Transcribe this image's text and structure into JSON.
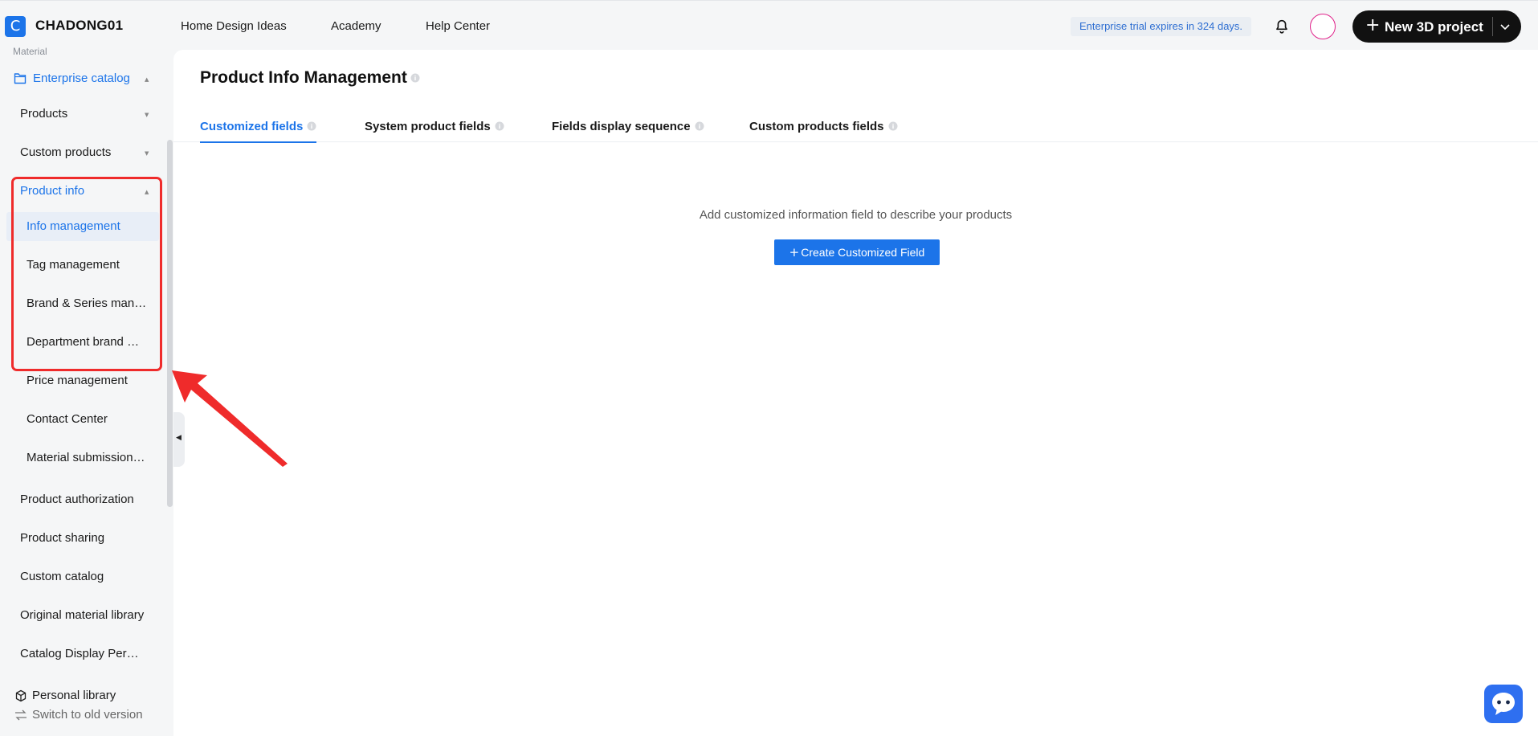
{
  "header": {
    "logo_letter": "C",
    "brand": "CHADONG01",
    "nav": [
      "Home Design Ideas",
      "Academy",
      "Help Center"
    ],
    "trial_notice": "Enterprise trial expires in 324 days.",
    "new_project_label": "New 3D project"
  },
  "sidebar": {
    "section_label": "Material",
    "catalog_label": "Enterprise catalog",
    "items": [
      {
        "label": "Products"
      },
      {
        "label": "Custom products"
      },
      {
        "label": "Product info"
      },
      {
        "label": "Info management"
      },
      {
        "label": "Tag management"
      },
      {
        "label": "Brand & Series management"
      },
      {
        "label": "Department brand management"
      },
      {
        "label": "Price management"
      },
      {
        "label": "Contact Center"
      },
      {
        "label": "Material submission management"
      },
      {
        "label": "Product authorization"
      },
      {
        "label": "Product sharing"
      },
      {
        "label": "Custom catalog"
      },
      {
        "label": "Original material library"
      },
      {
        "label": "Catalog Display Permissions"
      }
    ],
    "personal_library": "Personal library",
    "switch_version": "Switch to old version"
  },
  "main": {
    "title": "Product Info Management",
    "tabs": [
      {
        "label": "Customized fields",
        "active": true
      },
      {
        "label": "System product fields",
        "active": false
      },
      {
        "label": "Fields display sequence",
        "active": false
      },
      {
        "label": "Custom products fields",
        "active": false
      }
    ],
    "empty_hint": "Add customized information field to describe your products",
    "create_button": "Create Customized Field"
  },
  "colors": {
    "accent": "#1c74e9",
    "highlight": "#ef2b2b",
    "dark_button": "#111111"
  }
}
